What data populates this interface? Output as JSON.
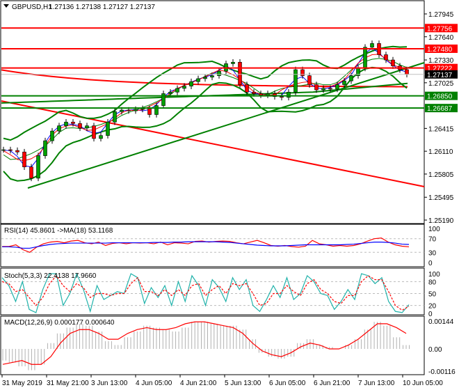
{
  "symbol_title": "GBPUSD,H1",
  "ohlc_header": "1.27136 1.27138 1.27127 1.27137",
  "colors": {
    "bull": "#00a000",
    "bear": "#ff0000",
    "band": "#008000",
    "red": "#ff0000",
    "rsi_ma": "#0000ff",
    "stoch": "#20b2aa"
  },
  "chart_data": [
    {
      "type": "line",
      "title": "GBPUSD,H1",
      "price_ticks": [
        "1.27945",
        "1.27640",
        "1.27330",
        "1.27025",
        "1.26415",
        "1.26110",
        "1.25805",
        "1.25495",
        "1.25190"
      ],
      "ylim": [
        1.2519,
        1.27945
      ],
      "closes": [
        1.2613,
        1.2612,
        1.261,
        1.259,
        1.2575,
        1.2605,
        1.2625,
        1.2638,
        1.2645,
        1.265,
        1.2648,
        1.2642,
        1.2645,
        1.2628,
        1.2632,
        1.265,
        1.2664,
        1.2666,
        1.2665,
        1.2667,
        1.2668,
        1.266,
        1.2672,
        1.2688,
        1.269,
        1.2695,
        1.2698,
        1.2704,
        1.2708,
        1.271,
        1.2712,
        1.2718,
        1.2728,
        1.273,
        1.27,
        1.269,
        1.2688,
        1.2686,
        1.2688,
        1.2684,
        1.2683,
        1.269,
        1.272,
        1.2712,
        1.27,
        1.2693,
        1.2695,
        1.2694,
        1.27,
        1.2705,
        1.2712,
        1.2722,
        1.275,
        1.2755,
        1.274,
        1.2733,
        1.2725,
        1.272,
        1.27137
      ],
      "levels": [
        {
          "label": "1.27756",
          "value": 1.27756,
          "color": "#ff0000"
        },
        {
          "label": "1.27480",
          "value": 1.2748,
          "color": "#ff0000"
        },
        {
          "label": "1.27222",
          "value": 1.27222,
          "color": "#ff0000"
        },
        {
          "label": "1.27137",
          "value": 1.27137,
          "color": "#000000"
        },
        {
          "label": "1.26850",
          "value": 1.2685,
          "color": "#008000"
        },
        {
          "label": "1.26687",
          "value": 1.26687,
          "color": "#008000"
        }
      ],
      "x_labels": [
        "31 May 2019",
        "31 May 21:00",
        "3 Jun 13:00",
        "4 Jun 05:00",
        "4 Jun 21:00",
        "5 Jun 13:00",
        "6 Jun 05:00",
        "6 Jun 21:00",
        "7 Jun 13:00",
        "10 Jun 05:00"
      ]
    },
    {
      "type": "line",
      "title": "RSI(14) 45.8601  ->MA(18) 53.1168",
      "ticks": [
        "100",
        "70",
        "30",
        "0"
      ],
      "ylim": [
        0,
        100
      ],
      "rsi": [
        47,
        47,
        52,
        38,
        30,
        45,
        55,
        60,
        62,
        58,
        63,
        65,
        58,
        55,
        60,
        50,
        56,
        58,
        55,
        58,
        57,
        58,
        55,
        60,
        52,
        58,
        57,
        55,
        62,
        63,
        60,
        62,
        63,
        62,
        58,
        55,
        60,
        65,
        58,
        50,
        48,
        50,
        47,
        45,
        48,
        65,
        55,
        52,
        48,
        50,
        48,
        50,
        55,
        63,
        70,
        72,
        60,
        52,
        48,
        46
      ],
      "rsi_ma": [
        46,
        46,
        45,
        42,
        42,
        46,
        50,
        53,
        55,
        56,
        57,
        57,
        57,
        57,
        57,
        57,
        58,
        58,
        58,
        58,
        58,
        58,
        59,
        59,
        59,
        60,
        60,
        61,
        61,
        61,
        61,
        61,
        60,
        59,
        57,
        55,
        53,
        51,
        50,
        49,
        49,
        49,
        50,
        51,
        52,
        52,
        52,
        52,
        52,
        52,
        53,
        54,
        56,
        58,
        60,
        60,
        59,
        57,
        54,
        53
      ]
    },
    {
      "type": "line",
      "title": "Stoch(5,3,3) 22.4138 17.9660",
      "ticks": [
        "100",
        "80",
        "50",
        "20",
        "0"
      ],
      "ylim": [
        0,
        100
      ],
      "k": [
        90,
        70,
        30,
        80,
        10,
        2,
        60,
        100,
        100,
        20,
        50,
        100,
        60,
        5,
        70,
        35,
        45,
        55,
        50,
        100,
        90,
        25,
        65,
        40,
        70,
        20,
        80,
        30,
        95,
        70,
        20,
        85,
        65,
        30,
        90,
        60,
        85,
        20,
        5,
        35,
        70,
        40,
        90,
        35,
        50,
        95,
        80,
        50,
        45,
        10,
        30,
        60,
        35,
        100,
        95,
        75,
        90,
        30,
        5,
        2,
        22
      ],
      "d": [
        80,
        75,
        55,
        60,
        40,
        20,
        40,
        75,
        95,
        70,
        55,
        75,
        65,
        40,
        50,
        50,
        45,
        50,
        50,
        75,
        90,
        55,
        55,
        45,
        60,
        45,
        60,
        45,
        70,
        75,
        45,
        60,
        70,
        50,
        75,
        70,
        75,
        50,
        20,
        25,
        50,
        50,
        70,
        55,
        45,
        75,
        85,
        60,
        50,
        30,
        25,
        45,
        45,
        80,
        95,
        85,
        85,
        55,
        20,
        8,
        18
      ]
    },
    {
      "type": "bar",
      "title": "MACD(12,26,9) 0.000177 0.000640",
      "ticks": [
        "0.00144",
        "0.00",
        "-0.00116"
      ],
      "ylim": [
        -0.00116,
        0.00144
      ],
      "histogram": [
        -0.0006,
        -0.0007,
        -0.0009,
        -0.0011,
        -0.0008,
        0.0003,
        0.0008,
        0.0011,
        0.0013,
        0.0012,
        0.0009,
        0.0004,
        0.0002,
        0.0006,
        0.0009,
        0.0012,
        0.0011,
        0.001,
        0.0009,
        0.0011,
        0.0014,
        0.0014,
        0.0013,
        0.0012,
        0.0012,
        0.001,
        0.0005,
        -0.0002,
        -0.0004,
        -0.0005,
        -0.0004,
        0.0003,
        0.0005,
        0.0002,
        0.0001,
        0.0,
        0.0002,
        0.0005,
        0.001,
        0.0014,
        0.0012,
        0.0006,
        0.0002
      ],
      "signal": [
        -0.0008,
        -0.0007,
        -0.0006,
        -0.0008,
        -0.0008,
        -0.0004,
        0.0003,
        0.0008,
        0.001,
        0.001,
        0.0008,
        0.0005,
        0.0005,
        0.0008,
        0.001,
        0.0011,
        0.001,
        0.001,
        0.0011,
        0.0013,
        0.0014,
        0.0014,
        0.0013,
        0.0012,
        0.0011,
        0.0008,
        0.0003,
        -0.0001,
        -0.0003,
        -0.0004,
        -0.0002,
        0.0001,
        0.0003,
        0.0002,
        0.0,
        0.0,
        0.0002,
        0.0005,
        0.0009,
        0.0013,
        0.0013,
        0.0011,
        0.0008
      ]
    }
  ]
}
